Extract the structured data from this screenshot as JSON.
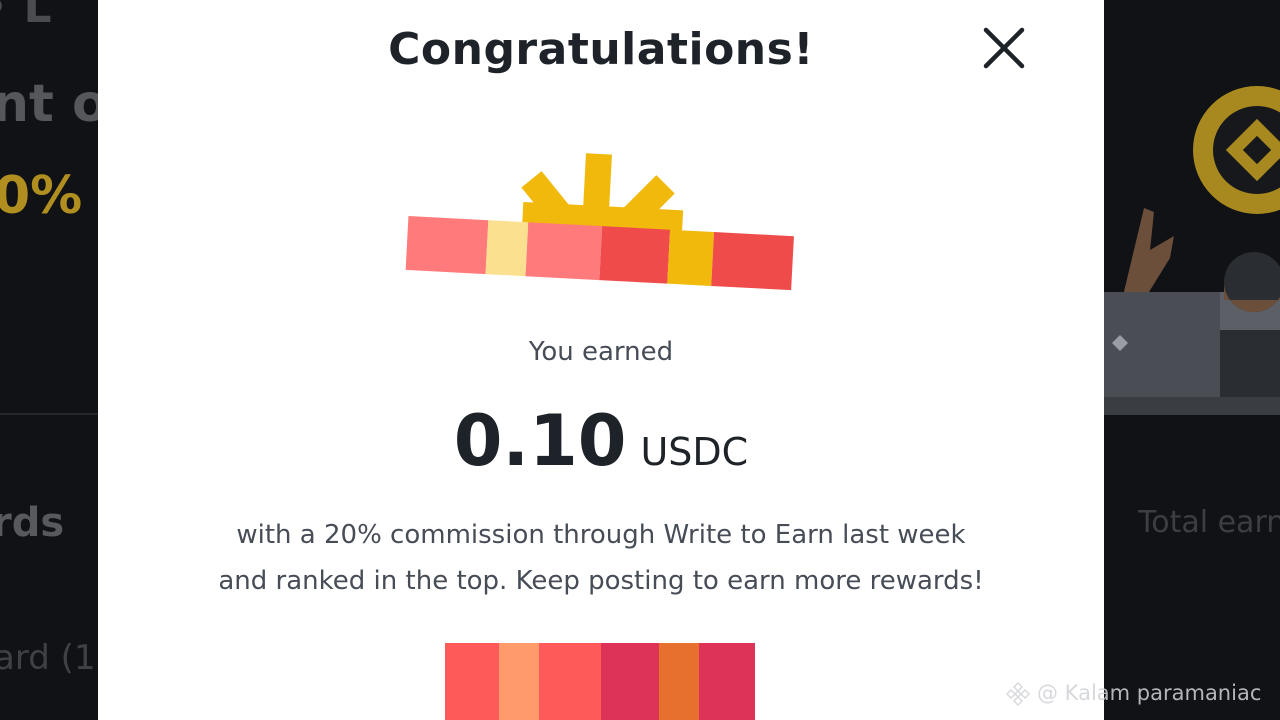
{
  "background": {
    "fragments": [
      "• L",
      "nt or",
      "0%",
      "rds",
      "ard (1",
      "Total earn"
    ]
  },
  "modal": {
    "title": "Congratulations!",
    "close_icon": "close-icon",
    "earned_label": "You earned",
    "amount": "0.10",
    "currency": "USDC",
    "description_line1": "with a 20% commission through Write to Earn last week",
    "description_line2": "and ranked in the top. Keep posting to earn more rewards!"
  },
  "watermark": {
    "text": "@ Kalam paramaniac",
    "icon": "binance-logo-icon"
  },
  "colors": {
    "accent_gold": "#f0b90b",
    "text_primary": "#1e2329",
    "text_secondary": "#474d57"
  }
}
